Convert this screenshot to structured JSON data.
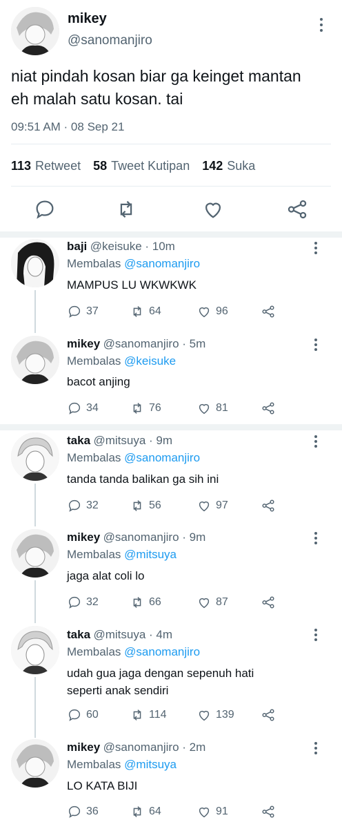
{
  "main_tweet": {
    "name": "mikey",
    "handle": "@sanomanjiro",
    "text_line1": "niat pindah kosan biar ga keinget mantan",
    "text_line2": "eh malah satu kosan. tai",
    "timestamp": "09:51 AM · 08 Sep 21",
    "stats": {
      "retweets_num": "113",
      "retweets_label": "Retweet",
      "quotes_num": "58",
      "quotes_label": "Tweet Kutipan",
      "likes_num": "142",
      "likes_label": "Suka"
    },
    "icons": [
      "reply-icon",
      "retweet-icon",
      "like-icon",
      "share-icon"
    ]
  },
  "replies": [
    {
      "name": "baji",
      "handle": "@keisuke · 10m",
      "replying_label": "Membalas",
      "replying_to": "@sanomanjiro",
      "text_line1": "MAMPUS LU WKWKWK",
      "text_line2": "",
      "reply_count": "37",
      "retweet_count": "64",
      "like_count": "96"
    },
    {
      "name": "mikey",
      "handle": "@sanomanjiro · 5m",
      "replying_label": "Membalas",
      "replying_to": "@keisuke",
      "text_line1": "bacot anjing",
      "text_line2": "",
      "reply_count": "34",
      "retweet_count": "76",
      "like_count": "81"
    },
    {
      "name": "taka",
      "handle": "@mitsuya · 9m",
      "replying_label": "Membalas",
      "replying_to": "@sanomanjiro",
      "text_line1": "tanda tanda balikan ga sih ini",
      "text_line2": "",
      "reply_count": "32",
      "retweet_count": "56",
      "like_count": "97"
    },
    {
      "name": "mikey",
      "handle": "@sanomanjiro · 9m",
      "replying_label": "Membalas",
      "replying_to": "@mitsuya",
      "text_line1": "jaga alat coli lo",
      "text_line2": "",
      "reply_count": "32",
      "retweet_count": "66",
      "like_count": "87"
    },
    {
      "name": "taka",
      "handle": "@mitsuya · 4m",
      "replying_label": "Membalas",
      "replying_to": "@sanomanjiro",
      "text_line1": "udah gua jaga dengan sepenuh hati",
      "text_line2": "seperti anak sendiri",
      "reply_count": "60",
      "retweet_count": "114",
      "like_count": "139"
    },
    {
      "name": "mikey",
      "handle": "@sanomanjiro · 2m",
      "replying_label": "Membalas",
      "replying_to": "@mitsuya",
      "text_line1": "LO KATA BIJI",
      "text_line2": "",
      "reply_count": "36",
      "retweet_count": "64",
      "like_count": "91"
    }
  ],
  "colors": {
    "text": "#0f1419",
    "muted": "#536471",
    "link": "#1d9bf0",
    "divider": "#e6ecf0"
  }
}
